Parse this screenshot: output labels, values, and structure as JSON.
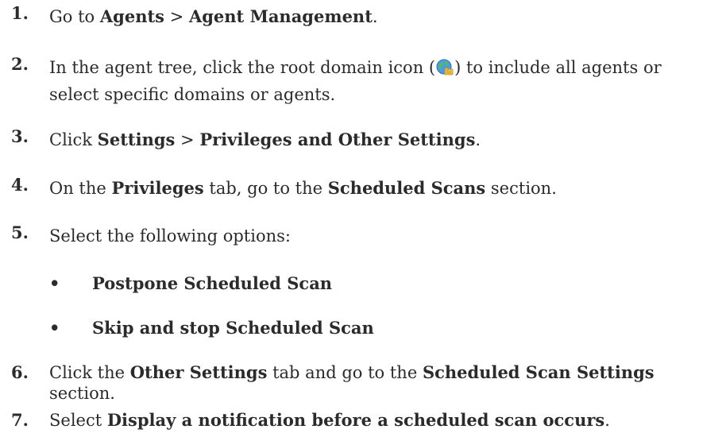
{
  "steps": [
    {
      "number": "1.",
      "parts": [
        "Go to ",
        "Agents",
        " > ",
        "Agent Management",
        "."
      ]
    },
    {
      "number": "2.",
      "line1_before": "In the agent tree, click the root domain icon (",
      "line1_after": ") to include all agents or",
      "line2": "select specific domains or agents."
    },
    {
      "number": "3.",
      "parts": [
        "Click ",
        "Settings",
        " > ",
        "Privileges and Other Settings",
        "."
      ]
    },
    {
      "number": "4.",
      "parts": [
        "On the ",
        "Privileges",
        " tab, go to the ",
        "Scheduled Scans",
        " section."
      ]
    },
    {
      "number": "5.",
      "text": "Select the following options:"
    },
    {
      "number": "6.",
      "parts": [
        "Click the ",
        "Other Settings",
        " tab and go to the ",
        "Scheduled Scan Settings"
      ],
      "line2": "section."
    },
    {
      "number": "7.",
      "parts": [
        "Select ",
        "Display a notification before a scheduled scan occurs",
        "."
      ]
    }
  ],
  "bullet_symbol": "•",
  "options": [
    "Postpone Scheduled Scan",
    "Skip and stop Scheduled Scan"
  ],
  "icons": {
    "root_domain": "globe-folder-icon"
  }
}
